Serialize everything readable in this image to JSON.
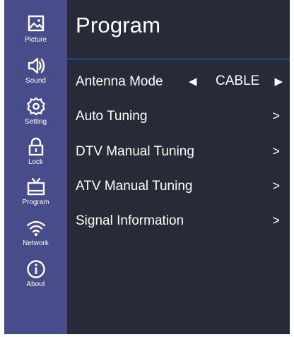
{
  "sidebar": {
    "items": [
      {
        "label": "Picture",
        "icon": "picture-icon"
      },
      {
        "label": "Sound",
        "icon": "speaker-icon"
      },
      {
        "label": "Setting",
        "icon": "gear-icon"
      },
      {
        "label": "Lock",
        "icon": "lock-icon"
      },
      {
        "label": "Program",
        "icon": "tv-icon"
      },
      {
        "label": "Network",
        "icon": "wifi-icon"
      },
      {
        "label": "About",
        "icon": "info-icon"
      }
    ]
  },
  "main": {
    "title": "Program",
    "rows": [
      {
        "label": "Antenna Mode",
        "value": "CABLE",
        "left_arrow": "◀",
        "right_arrow": "▶"
      },
      {
        "label": "Auto Tuning",
        "chevron": ">"
      },
      {
        "label": "DTV Manual Tuning",
        "chevron": ">"
      },
      {
        "label": "ATV Manual Tuning",
        "chevron": ">"
      },
      {
        "label": "Signal Information",
        "chevron": ">"
      }
    ]
  },
  "colors": {
    "sidebar_bg": "#484c8a",
    "panel_bg": "#262b37",
    "divider": "#1c3f6c",
    "text": "#ffffff"
  }
}
